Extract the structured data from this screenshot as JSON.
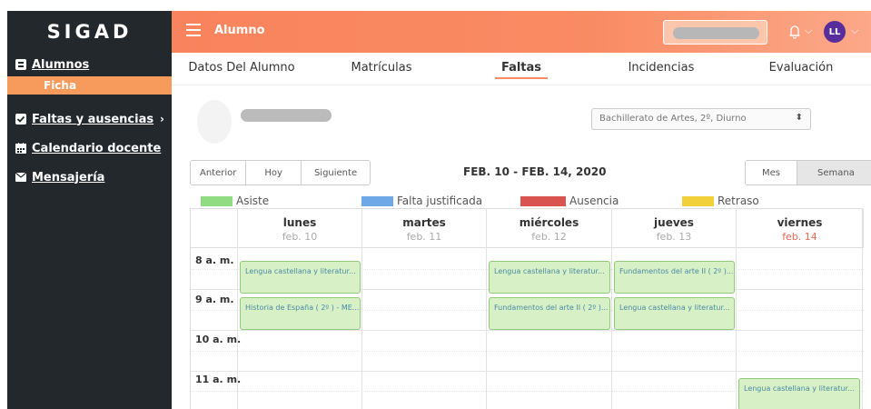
{
  "sidebar": {
    "logo": "SIGAD",
    "items": [
      {
        "label": "Alumnos",
        "icon": "id-card-icon"
      },
      {
        "label": "Faltas y ausencias",
        "icon": "checkbox-icon"
      },
      {
        "label": "Calendario docente",
        "icon": "calendar-icon"
      },
      {
        "label": "Mensajería",
        "icon": "envelope-icon"
      }
    ],
    "sub_item": "Ficha"
  },
  "topbar": {
    "title": "Alumno",
    "avatar_initials": "LL"
  },
  "tabs": [
    {
      "label": "Datos Del Alumno"
    },
    {
      "label": "Matrículas"
    },
    {
      "label": "Faltas"
    },
    {
      "label": "Incidencias"
    },
    {
      "label": "Evaluación"
    }
  ],
  "course_select": {
    "value": "Bachillerato de Artes, 2º, Diurno"
  },
  "calendar": {
    "nav": {
      "prev": "Anterior",
      "today": "Hoy",
      "next": "Siguiente"
    },
    "range_title": "FEB. 10 - FEB. 14, 2020",
    "views": {
      "month": "Mes",
      "week": "Semana"
    },
    "legend": [
      {
        "label": "Asiste",
        "color": "#8fdc83"
      },
      {
        "label": "Falta justificada",
        "color": "#6fa8e6"
      },
      {
        "label": "Ausencia",
        "color": "#d9534f"
      },
      {
        "label": "Retraso",
        "color": "#f2d039"
      }
    ],
    "days": [
      {
        "name": "lunes",
        "date": "feb. 10"
      },
      {
        "name": "martes",
        "date": "feb. 11"
      },
      {
        "name": "miércoles",
        "date": "feb. 12"
      },
      {
        "name": "jueves",
        "date": "feb. 13"
      },
      {
        "name": "viernes",
        "date": "feb. 14"
      }
    ],
    "times": [
      "8 a. m.",
      "9 a. m.",
      "10 a. m.",
      "11 a. m."
    ],
    "events": [
      {
        "day": 0,
        "slot": 0,
        "label": "Lengua castellana y literatur..."
      },
      {
        "day": 0,
        "slot": 1,
        "label": "Historia de España ( 2º ) - ME..."
      },
      {
        "day": 2,
        "slot": 0,
        "label": "Lengua castellana y literatur..."
      },
      {
        "day": 2,
        "slot": 1,
        "label": "Fundamentos del arte II ( 2º )..."
      },
      {
        "day": 3,
        "slot": 0,
        "label": "Fundamentos del arte II ( 2º )..."
      },
      {
        "day": 3,
        "slot": 1,
        "label": "Lengua castellana y literatur..."
      },
      {
        "day": 4,
        "slot": 3,
        "label": "Lengua castellana y literatur..."
      }
    ]
  }
}
